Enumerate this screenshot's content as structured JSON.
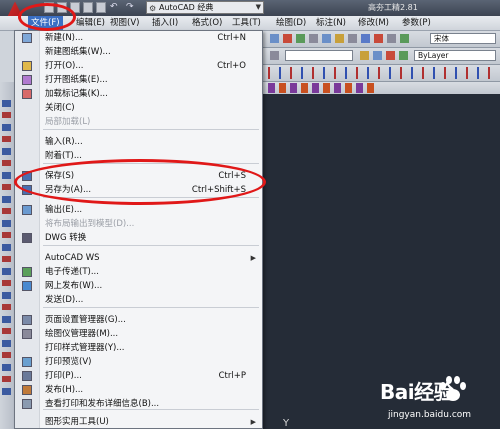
{
  "title_bar": {
    "workspace": "AutoCAD 经典",
    "title": "高夯工精2.81"
  },
  "menu_bar": {
    "items": [
      "文件(F)",
      "编辑(E)",
      "视图(V)",
      "插入(I)",
      "格式(O)",
      "工具(T)",
      "绘图(D)",
      "标注(N)",
      "修改(M)",
      "参数(P)"
    ]
  },
  "toolbar": {
    "layer_dropdown": "ByLayer",
    "font_dropdown": "宋体"
  },
  "drawing": {
    "view_label": "[-]"
  },
  "file_menu": {
    "items": [
      {
        "label": "新建(N)...",
        "shortcut": "Ctrl+N",
        "icon": "new-file-icon",
        "disabled": false
      },
      {
        "label": "新建图纸集(W)...",
        "shortcut": "",
        "icon": "",
        "disabled": false
      },
      {
        "label": "打开(O)...",
        "shortcut": "Ctrl+O",
        "icon": "open-folder-icon",
        "disabled": false
      },
      {
        "label": "打开图纸集(E)...",
        "shortcut": "",
        "icon": "open-sheetset-icon",
        "disabled": false
      },
      {
        "label": "加载标记集(K)...",
        "shortcut": "",
        "icon": "markup-icon",
        "disabled": false
      },
      {
        "label": "关闭(C)",
        "shortcut": "",
        "icon": "",
        "disabled": false
      },
      {
        "label": "局部加载(L)",
        "shortcut": "",
        "icon": "",
        "disabled": true
      },
      {
        "label": "输入(R)...",
        "shortcut": "",
        "icon": "",
        "disabled": false
      },
      {
        "label": "附着(T)...",
        "shortcut": "",
        "icon": "",
        "disabled": false
      },
      {
        "label": "保存(S)",
        "shortcut": "Ctrl+S",
        "icon": "save-icon",
        "disabled": false
      },
      {
        "label": "另存为(A)...",
        "shortcut": "Ctrl+Shift+S",
        "icon": "save-as-icon",
        "disabled": false
      },
      {
        "label": "输出(E)...",
        "shortcut": "",
        "icon": "export-icon",
        "disabled": false
      },
      {
        "label": "将布局输出到模型(D)...",
        "shortcut": "",
        "icon": "",
        "disabled": true
      },
      {
        "label": "DWG 转换",
        "shortcut": "",
        "icon": "dwg-convert-icon",
        "disabled": false
      },
      {
        "label": "AutoCAD WS",
        "shortcut": "",
        "icon": "",
        "disabled": false,
        "submenu": true
      },
      {
        "label": "电子传递(T)...",
        "shortcut": "",
        "icon": "etransmit-icon",
        "disabled": false
      },
      {
        "label": "网上发布(W)...",
        "shortcut": "",
        "icon": "publish-web-icon",
        "disabled": false
      },
      {
        "label": "发送(D)...",
        "shortcut": "",
        "icon": "",
        "disabled": false
      },
      {
        "label": "页面设置管理器(G)...",
        "shortcut": "",
        "icon": "page-setup-icon",
        "disabled": false
      },
      {
        "label": "绘图仪管理器(M)...",
        "shortcut": "",
        "icon": "plotter-icon",
        "disabled": false
      },
      {
        "label": "打印样式管理器(Y)...",
        "shortcut": "",
        "icon": "",
        "disabled": false
      },
      {
        "label": "打印预览(V)",
        "shortcut": "",
        "icon": "print-preview-icon",
        "disabled": false
      },
      {
        "label": "打印(P)...",
        "shortcut": "Ctrl+P",
        "icon": "print-icon",
        "disabled": false
      },
      {
        "label": "发布(H)...",
        "shortcut": "",
        "icon": "publish-icon",
        "disabled": false
      },
      {
        "label": "查看打印和发布详细信息(B)...",
        "shortcut": "",
        "icon": "plot-details-icon",
        "disabled": false
      },
      {
        "label": "图形实用工具(U)",
        "shortcut": "",
        "icon": "",
        "disabled": false,
        "submenu": true
      }
    ]
  },
  "watermark": {
    "brand": "Bai经验",
    "url": "jingyan.baidu.com"
  },
  "colors": {
    "highlight_oval": "#e01818",
    "menu_bg": "#f4f5f7",
    "canvas_bg": "#252c37"
  }
}
